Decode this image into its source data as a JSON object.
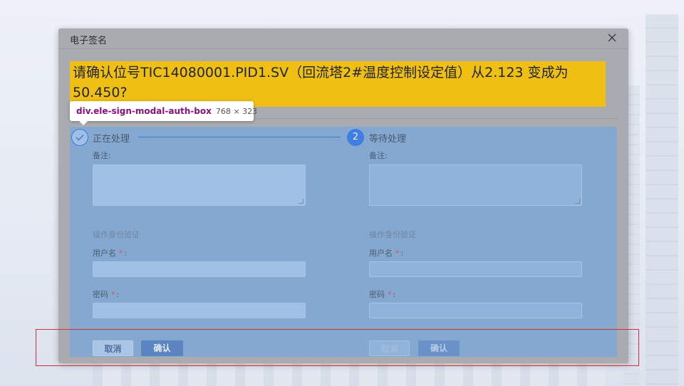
{
  "modal": {
    "title": "电子签名",
    "close_icon": "close-icon",
    "question": "请确认位号TIC14080001.PID1.SV（回流塔2#温度控制设定值）从2.123 变成为 50.450?"
  },
  "tooltip": {
    "selector": "div.ele-sign-modal-auth-box",
    "size": "768 × 323"
  },
  "steps": [
    {
      "icon": "check-icon",
      "label": "正在处理"
    },
    {
      "number": "2",
      "label": "等待处理"
    }
  ],
  "left_form": {
    "remark_label": "备注:",
    "section_title": "操作身份验证",
    "username_label": "用户名",
    "password_label": "密码",
    "required_mark": "*",
    "colon": ":",
    "cancel": "取消",
    "confirm": "确认"
  },
  "right_form": {
    "remark_label": "备注:",
    "section_title": "操作身份验证",
    "username_label": "用户名",
    "password_label": "密码",
    "required_mark": "*",
    "colon": ":",
    "cancel": "取消",
    "confirm": "确认"
  },
  "colors": {
    "question_bg": "#efbf13",
    "auth_box_bg": "#84a8cf",
    "active_step": "#3d7ad6",
    "highlight_border": "#d0303a"
  }
}
